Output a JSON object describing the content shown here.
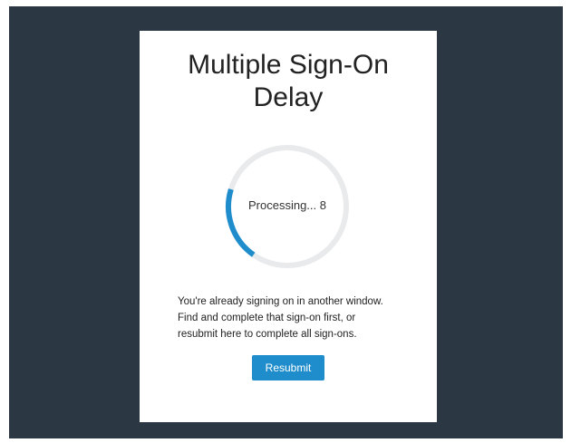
{
  "dialog": {
    "title_line1": "Multiple Sign-On",
    "title_line2": "Delay",
    "spinner": {
      "label": "Processing... 8",
      "progress": 0.2
    },
    "message_lines": [
      "You're already signing on in another window.",
      "Find and complete that sign-on first, or",
      "resubmit here to complete all sign-ons."
    ],
    "resubmit_label": "Resubmit"
  },
  "colors": {
    "backdrop": "#2b3742",
    "card": "#ffffff",
    "accent": "#1f8dcc",
    "track": "#e8eaec"
  }
}
